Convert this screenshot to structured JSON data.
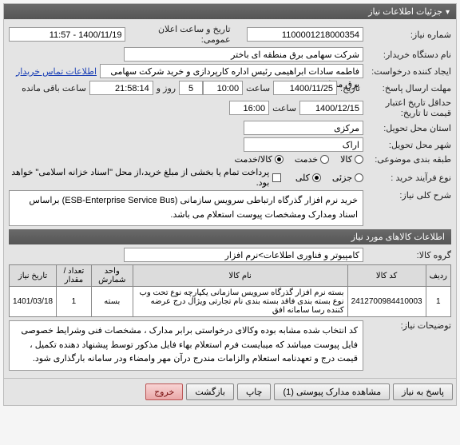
{
  "panel": {
    "title": "جزئیات اطلاعات نیاز"
  },
  "fields": {
    "need_no_label": "شماره نیاز:",
    "need_no": "1100001218000354",
    "announce_label": "تاریخ و ساعت اعلان عمومی:",
    "announce": "1400/11/19 - 11:57",
    "org_label": "نام دستگاه خریدار:",
    "org": "شرکت سهامی برق منطقه ای باختر",
    "creator_label": "ایجاد کننده درخواست:",
    "creator": "فاطمه سادات ابراهیمی رئیس اداره کارپردازی و خرید شرکت سهامی برق منطقه",
    "contact_link": "اطلاعات تماس خریدار",
    "deadline_label": "مهلت ارسال پاسخ:",
    "deadline_tarikh_label": "تاریخ:",
    "deadline_date": "1400/11/25",
    "deadline_time_label": "ساعت",
    "deadline_time": "10:00",
    "remain_roz_label": "روز و",
    "remain_days": "5",
    "remain_time": "21:58:14",
    "remain_tail": "ساعت باقی مانده",
    "valid_label": "حداقل تاریخ اعتبار قیمت تا تاریخ:",
    "valid_date": "1400/12/15",
    "valid_time_label": "ساعت",
    "valid_time": "16:00",
    "province_label": "استان محل تحویل:",
    "province": "مرکزی",
    "city_label": "شهر محل تحویل:",
    "city": "اراک",
    "category_label": "طبقه بندی موضوعی:",
    "cat_goods": "کالا",
    "cat_service": "خدمت",
    "cat_goods_service": "کالا/خدمت",
    "buy_type_label": "نوع فرآیند خرید :",
    "buy_partial": "جزئی",
    "buy_full": "کلی",
    "pay_note": "پرداخت تمام یا بخشی از مبلغ خرید،از محل \"اسناد خزانه اسلامی\" خواهد بود.",
    "summary_label": "شرح کلی نیاز:",
    "summary": "خرید نرم افزار گذرگاه ارتباطی سرویس سازمانی (ESB-Enterprise Service Bus) براساس اسناد ومدارک ومشخصات پیوست استعلام می باشد.",
    "notes_label": "توضیحات نیاز:",
    "notes": "کد انتخاب شده مشابه بوده وکالای درخواستی برابر مدارک ، مشخصات فنی وشرایط خصوصی فایل پیوست میباشد که میبایست فرم استعلام بهاء فایل مذکور توسط پیشنهاد دهنده تکمیل ، قیمت درج و تعهدنامه استعلام والزامات  مندرج درآن مهر وامضاء ودر سامانه بارگذاری شود."
  },
  "items_section": {
    "title": "اطلاعات کالاهای مورد نیاز",
    "group_label": "گروه کالا:",
    "group": "کامپیوتر و فناوری اطلاعات>نرم افزار"
  },
  "table": {
    "headers": {
      "row": "ردیف",
      "code": "کد کالا",
      "name": "نام کالا",
      "unit": "واحد شمارش",
      "qty": "تعداد / مقدار",
      "date": "تاریخ نیاز"
    },
    "rows": [
      {
        "row": "1",
        "code": "2412700984410003",
        "name": "بسته نرم افزار گذرگاه سرویس سازمانی یکپارچه نوع تحت وب نوع بسته بندی فاقد بسته بندی نام تجارتی ویژال درج عرضه کننده رسا سامانه افق",
        "unit": "بسته",
        "qty": "1",
        "date": "1401/03/18"
      }
    ]
  },
  "buttons": {
    "reply": "پاسخ به نیاز",
    "attachments": "مشاهده مدارک پیوستی (1)",
    "print": "چاپ",
    "back": "بازگشت",
    "exit": "خروج"
  }
}
